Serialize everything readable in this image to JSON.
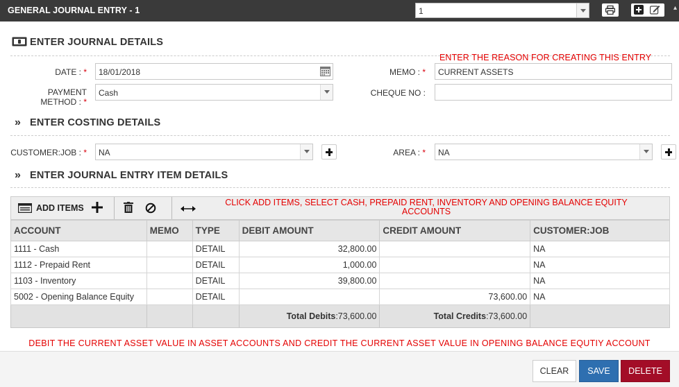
{
  "window": {
    "title": "GENERAL JOURNAL ENTRY - 1",
    "selector_value": "1",
    "icons": [
      "print-icon",
      "add-icon",
      "edit-icon"
    ]
  },
  "journal_details": {
    "heading": "ENTER JOURNAL DETAILS",
    "date_label": "DATE :",
    "date_value": "18/01/2018",
    "payment_label_1": "PAYMENT",
    "payment_label_2": "METHOD :",
    "payment_value": "Cash",
    "memo_label": "MEMO :",
    "memo_value": "CURRENT ASSETS",
    "cheque_label": "CHEQUE NO :",
    "cheque_value": "",
    "required_mark": "*",
    "memo_note": "ENTER THE REASON FOR CREATING THIS ENTRY"
  },
  "costing_details": {
    "heading": "ENTER COSTING DETAILS",
    "customer_label": "CUSTOMER:JOB :",
    "customer_value": "NA",
    "area_label": "AREA :",
    "area_value": "NA"
  },
  "item_details": {
    "heading": "ENTER JOURNAL ENTRY ITEM DETAILS",
    "add_items_label": "ADD ITEMS",
    "toolbar_note": "CLICK ADD ITEMS, SELECT CASH, PREPAID RENT, INVENTORY AND OPENING BALANCE EQUITY ACCOUNTS"
  },
  "table": {
    "columns": [
      "ACCOUNT",
      "MEMO",
      "TYPE",
      "DEBIT AMOUNT",
      "CREDIT AMOUNT",
      "CUSTOMER:JOB"
    ],
    "rows": [
      {
        "account": "1111 - Cash",
        "memo": "",
        "type": "DETAIL",
        "debit": "32,800.00",
        "credit": "",
        "customer": "NA"
      },
      {
        "account": "1112 - Prepaid Rent",
        "memo": "",
        "type": "DETAIL",
        "debit": "1,000.00",
        "credit": "",
        "customer": "NA"
      },
      {
        "account": "1103 - Inventory",
        "memo": "",
        "type": "DETAIL",
        "debit": "39,800.00",
        "credit": "",
        "customer": "NA"
      },
      {
        "account": "5002 - Opening Balance Equity",
        "memo": "",
        "type": "DETAIL",
        "debit": "",
        "credit": "73,600.00",
        "customer": "NA"
      }
    ],
    "total_debits_label": "Total Debits",
    "total_debits_value": ":73,600.00",
    "total_credits_label": "Total Credits",
    "total_credits_value": ":73,600.00"
  },
  "footer": {
    "instruction": "DEBIT THE CURRENT ASSET VALUE IN ASSET ACCOUNTS AND CREDIT THE CURRENT ASSET VALUE IN OPENING BALANCE EQUTIY ACCOUNT",
    "clear_label": "CLEAR",
    "save_label": "SAVE",
    "delete_label": "DELETE"
  },
  "colors": {
    "titlebar": "#3a3a3a",
    "note_red": "#e40000",
    "save_blue": "#2e6fb0",
    "delete_red": "#a30d27"
  }
}
